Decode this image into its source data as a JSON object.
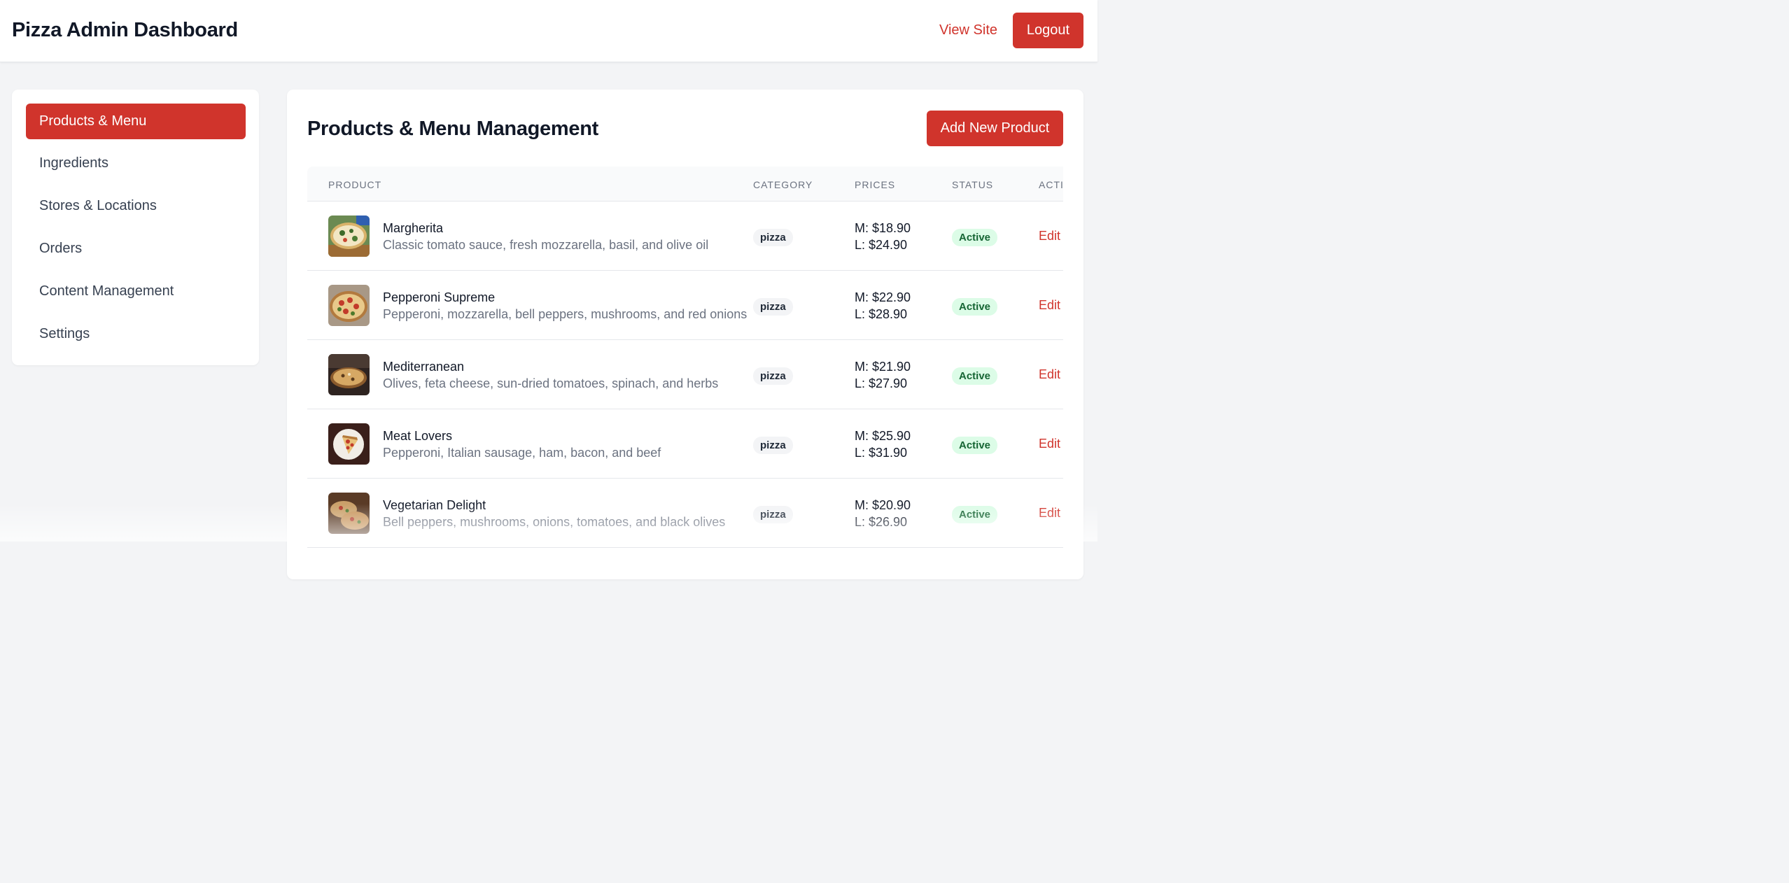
{
  "header": {
    "title": "Pizza Admin Dashboard",
    "view_site_label": "View Site",
    "logout_label": "Logout"
  },
  "sidebar": {
    "items": [
      {
        "label": "Products & Menu",
        "active": true
      },
      {
        "label": "Ingredients",
        "active": false
      },
      {
        "label": "Stores & Locations",
        "active": false
      },
      {
        "label": "Orders",
        "active": false
      },
      {
        "label": "Content Management",
        "active": false
      },
      {
        "label": "Settings",
        "active": false
      }
    ]
  },
  "main": {
    "title": "Products & Menu Management",
    "add_button_label": "Add New Product",
    "table": {
      "columns": [
        "PRODUCT",
        "CATEGORY",
        "PRICES",
        "STATUS",
        "ACTIONS"
      ],
      "rows": [
        {
          "name": "Margherita",
          "description": "Classic tomato sauce, fresh mozzarella, basil, and olive oil",
          "category": "pizza",
          "price_m": "M: $18.90",
          "price_l": "L: $24.90",
          "status": "Active",
          "action": "Edit",
          "image": "pizza-margherita-image"
        },
        {
          "name": "Pepperoni Supreme",
          "description": "Pepperoni, mozzarella, bell peppers, mushrooms, and red onions",
          "category": "pizza",
          "price_m": "M: $22.90",
          "price_l": "L: $28.90",
          "status": "Active",
          "action": "Edit",
          "image": "pizza-pepperoni-image"
        },
        {
          "name": "Mediterranean",
          "description": "Olives, feta cheese, sun-dried tomatoes, spinach, and herbs",
          "category": "pizza",
          "price_m": "M: $21.90",
          "price_l": "L: $27.90",
          "status": "Active",
          "action": "Edit",
          "image": "pizza-mediterranean-image"
        },
        {
          "name": "Meat Lovers",
          "description": "Pepperoni, Italian sausage, ham, bacon, and beef",
          "category": "pizza",
          "price_m": "M: $25.90",
          "price_l": "L: $31.90",
          "status": "Active",
          "action": "Edit",
          "image": "pizza-slice-image"
        },
        {
          "name": "Vegetarian Delight",
          "description": "Bell peppers, mushrooms, onions, tomatoes, and black olives",
          "category": "pizza",
          "price_m": "M: $20.90",
          "price_l": "L: $26.90",
          "status": "Active",
          "action": "Edit",
          "image": "pizza-vegetarian-image"
        }
      ]
    }
  },
  "colors": {
    "accent": "#d0342c",
    "status_active_bg": "#dcfce7",
    "status_active_text": "#166534"
  }
}
